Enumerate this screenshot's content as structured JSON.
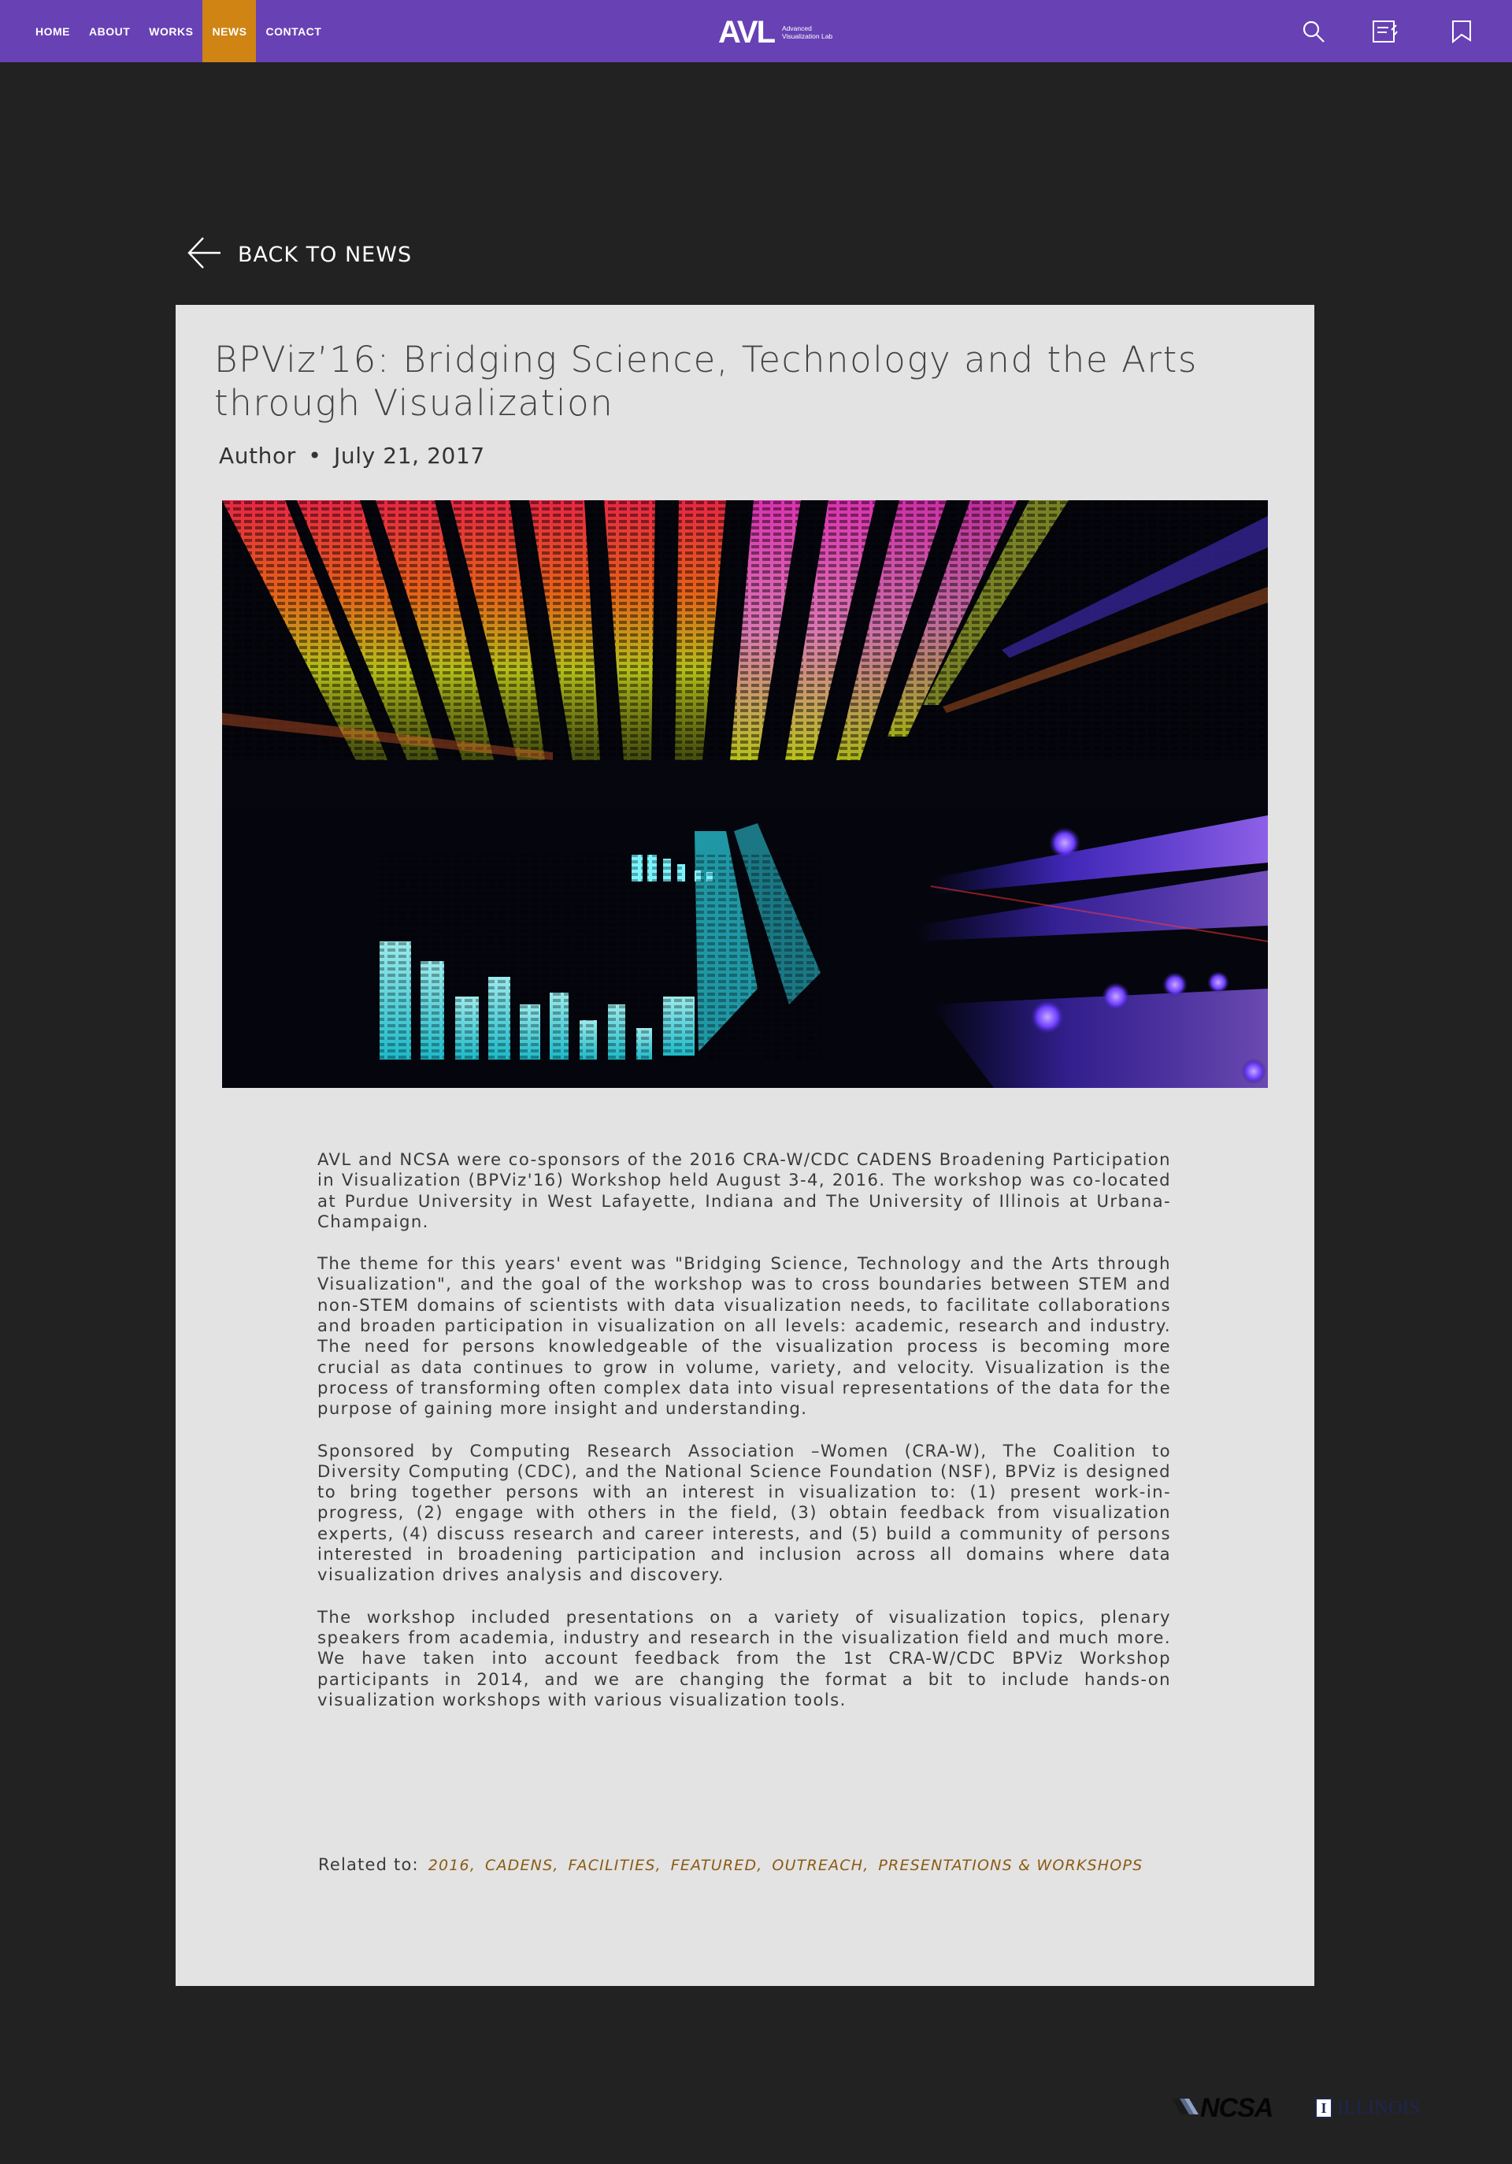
{
  "nav": {
    "items": [
      {
        "label": "HOME",
        "active": false
      },
      {
        "label": "ABOUT",
        "active": false
      },
      {
        "label": "WORKS",
        "active": false
      },
      {
        "label": "NEWS",
        "active": true
      },
      {
        "label": "CONTACT",
        "active": false
      }
    ],
    "logo": {
      "mark": "AVL",
      "sub_line1": "Advanced",
      "sub_line2": "Visualization Lab"
    },
    "icons": [
      "search-icon",
      "document-icon",
      "bookmark-icon"
    ],
    "bar_color": "#6841b5",
    "active_color": "#cf8413"
  },
  "back_link": {
    "label": "BACK TO NEWS"
  },
  "article": {
    "title": "BPViz’16: Bridging Science, Technology and the Arts through Visualization",
    "author": "Author",
    "separator": "•",
    "date": "July 21, 2017",
    "paragraphs": [
      "AVL and NCSA were co-sponsors of the 2016 CRA-W/CDC CADENS Broadening Participation in Visualization (BPViz'16) Workshop held August 3-4, 2016. The workshop was co-located at Purdue University in West Lafayette, Indiana and The University of Illinois at Urbana-Champaign.",
      "The theme for this years' event was \"Bridging Science, Technology and the Arts through Visualization\", and the goal of the workshop was to cross boundaries between STEM and non-STEM domains of scientists with data visualization needs, to facilitate collaborations and broaden participation in visualization on all levels: academic, research and industry. The need for persons knowledgeable of the visualization process is becoming more crucial as data continues to grow in volume, variety, and velocity. Visualization is the process of transforming often complex data into visual representations of the data for the purpose of gaining more insight and understanding.",
      "Sponsored by Computing Research Association –Women (CRA-W), The Coalition to Diversity Computing (CDC), and the National Science Foundation (NSF), BPViz is designed to bring together persons with an interest in visualization to: (1) present work-in-progress, (2) engage with others in the field, (3) obtain feedback from visualization experts, (4) discuss research and career interests, and (5) build a community of persons interested in broadening participation and inclusion across all domains where data visualization drives analysis and discovery.",
      "The workshop included presentations on a variety of visualization topics, plenary speakers from academia, industry and research in the visualization field and much more. We have taken into account feedback from the 1st CRA-W/CDC BPViz Workshop participants in 2014, and we are changing  the format a bit to include hands-on visualization workshops with various visualization tools."
    ],
    "related_label": "Related to:",
    "related_tags": [
      "2016,",
      "CADENS,",
      "FACILITIES,",
      "FEATURED,",
      "OUTREACH,",
      "PRESENTATIONS & WORKSHOPS"
    ],
    "tag_color": "#8b5a13"
  },
  "footer": {
    "ncsa_label": "NCSA",
    "illinois_label": "ILLINOIS",
    "illinois_mark": "I"
  }
}
